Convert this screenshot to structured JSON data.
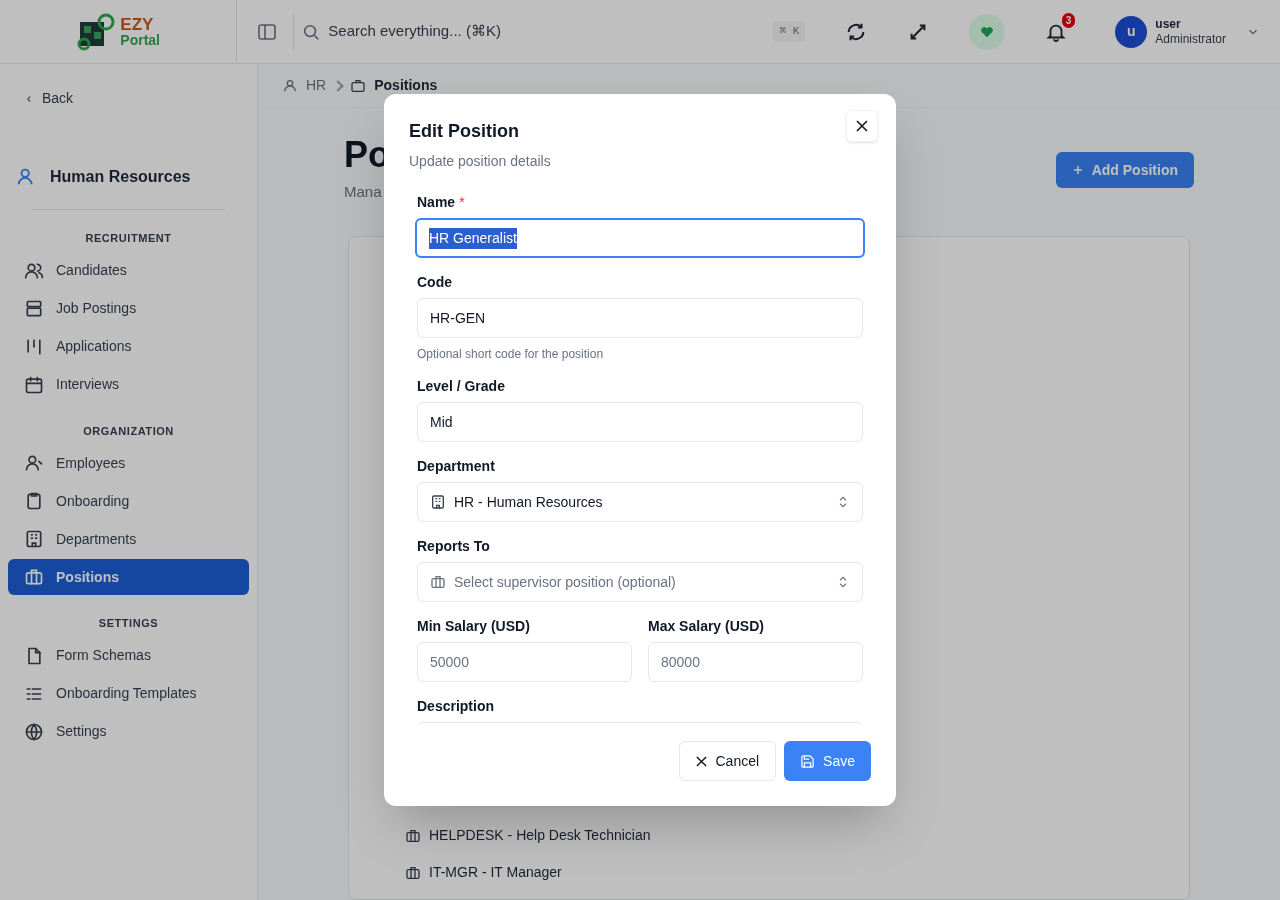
{
  "header": {
    "logo": {
      "line1": "EZY",
      "line2": "Portal"
    },
    "search": {
      "placeholder": "Search everything... (⌘K)",
      "shortcut": "⌘ K"
    },
    "notifications": {
      "count": "3"
    },
    "user": {
      "initial": "u",
      "name": "user",
      "role": "Administrator"
    }
  },
  "sidebar": {
    "back": "Back",
    "module": "Human Resources",
    "sections": [
      {
        "title": "RECRUITMENT",
        "items": [
          {
            "label": "Candidates",
            "selected": false
          },
          {
            "label": "Job Postings",
            "selected": false
          },
          {
            "label": "Applications",
            "selected": false
          },
          {
            "label": "Interviews",
            "selected": false
          }
        ]
      },
      {
        "title": "ORGANIZATION",
        "items": [
          {
            "label": "Employees",
            "selected": false
          },
          {
            "label": "Onboarding",
            "selected": false
          },
          {
            "label": "Departments",
            "selected": false
          },
          {
            "label": "Positions",
            "selected": true
          }
        ]
      },
      {
        "title": "SETTINGS",
        "items": [
          {
            "label": "Form Schemas",
            "selected": false
          },
          {
            "label": "Onboarding Templates",
            "selected": false
          },
          {
            "label": "Settings",
            "selected": false
          }
        ]
      }
    ]
  },
  "breadcrumb": [
    "HR",
    "Positions"
  ],
  "page": {
    "title": "Po",
    "subtitle": "Mana",
    "add_button": "Add Position",
    "list": [
      "HELPDESK - Help Desk Technician",
      "IT-MGR - IT Manager"
    ]
  },
  "dialog": {
    "title": "Edit Position",
    "subtitle": "Update position details",
    "fields": [
      {
        "kind": "text",
        "label": "Name",
        "required_mark": "*",
        "value": "HR Generalist",
        "focused": true
      },
      {
        "kind": "text",
        "label": "Code",
        "value": "HR-GEN",
        "hint": "Optional short code for the position"
      },
      {
        "kind": "text",
        "label": "Level / Grade",
        "value": "Mid"
      },
      {
        "kind": "select",
        "label": "Department",
        "value": "HR - Human Resources"
      },
      {
        "kind": "select",
        "label": "Reports To",
        "placeholder": "Select supervisor position (optional)"
      },
      {
        "kind": "pair",
        "items": [
          {
            "label": "Min Salary (USD)",
            "placeholder": "50000"
          },
          {
            "label": "Max Salary (USD)",
            "placeholder": "80000"
          }
        ]
      },
      {
        "kind": "textarea",
        "label": "Description"
      }
    ],
    "cancel": "Cancel",
    "save": "Save"
  }
}
